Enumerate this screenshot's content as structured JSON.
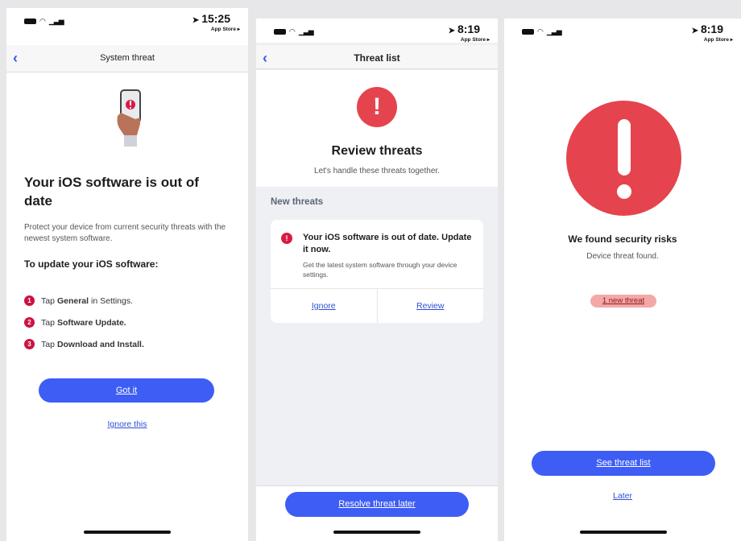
{
  "screen1": {
    "status": {
      "time": "15:25",
      "back_to": "App Store ▸"
    },
    "nav_title": "System threat",
    "heading": "Your iOS software is out of date",
    "description": "Protect your device from current security threats with the newest system software.",
    "subheading": "To update your iOS software:",
    "steps": [
      {
        "num": "1",
        "pre": "Tap",
        "bold": "General",
        "post": "in Settings."
      },
      {
        "num": "2",
        "pre": "Tap",
        "bold": "Software Update.",
        "post": ""
      },
      {
        "num": "3",
        "pre": "Tap",
        "bold": "Download and Install.",
        "post": ""
      }
    ],
    "primary_button": "Got it",
    "secondary_link": "Ignore this"
  },
  "screen2": {
    "status": {
      "time": "8:19",
      "back_to": "App Store ▸"
    },
    "nav_title": "Threat list",
    "alert_glyph": "!",
    "heading": "Review threats",
    "subheading": "Let's handle these threats together.",
    "section_title": "New threats",
    "card": {
      "title": "Your iOS software is out of date. Update it now.",
      "text": "Get the latest system software through your device settings.",
      "ignore": "Ignore",
      "review": "Review"
    },
    "bottom_button": "Resolve threat later"
  },
  "screen3": {
    "status": {
      "time": "8:19",
      "back_to": "App Store ▸"
    },
    "heading": "We found security risks",
    "subheading": "Device threat found.",
    "badge": "1 new threat",
    "primary_button": "See threat list",
    "secondary_link": "Later"
  },
  "colors": {
    "accent": "#3d5df5",
    "alert_red": "#e5444e",
    "step_red": "#cc1241",
    "link": "#2f4fd2"
  }
}
